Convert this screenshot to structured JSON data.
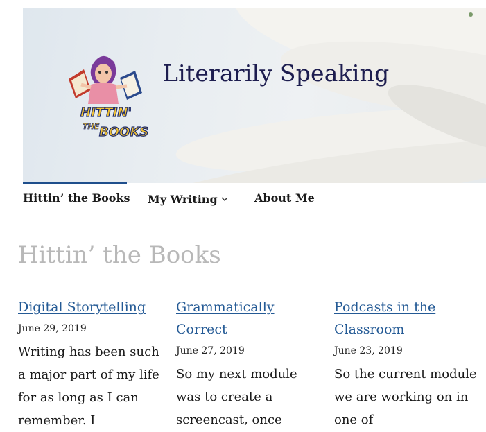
{
  "header": {
    "site_title": "Literarily Speaking",
    "logo_text_top": "HITTIN'",
    "logo_text_mid": "THE",
    "logo_text_bottom": "BOOKS"
  },
  "nav": {
    "items": [
      {
        "label": "Hittin’ the Books",
        "active": true
      },
      {
        "label": "My Writing",
        "has_dropdown": true
      },
      {
        "label": "About Me"
      }
    ],
    "accent_color": "#1f4f8c"
  },
  "page": {
    "title": "Hittin’ the Books"
  },
  "posts": [
    {
      "title": "Digital Storytelling",
      "date": "June 29, 2019",
      "excerpt": "Writing has been such a major part of my life for as long as I can remember. I"
    },
    {
      "title": "Grammatically Correct",
      "date": "June 27, 2019",
      "excerpt": "So my next module was to create a screencast, once"
    },
    {
      "title": "Podcasts in the Classroom",
      "date": "June 23, 2019",
      "excerpt": "So the current module we are working on in one of"
    }
  ],
  "colors": {
    "link": "#245a95",
    "title_gray": "#b8b8b8",
    "site_title": "#1d1d4f"
  }
}
